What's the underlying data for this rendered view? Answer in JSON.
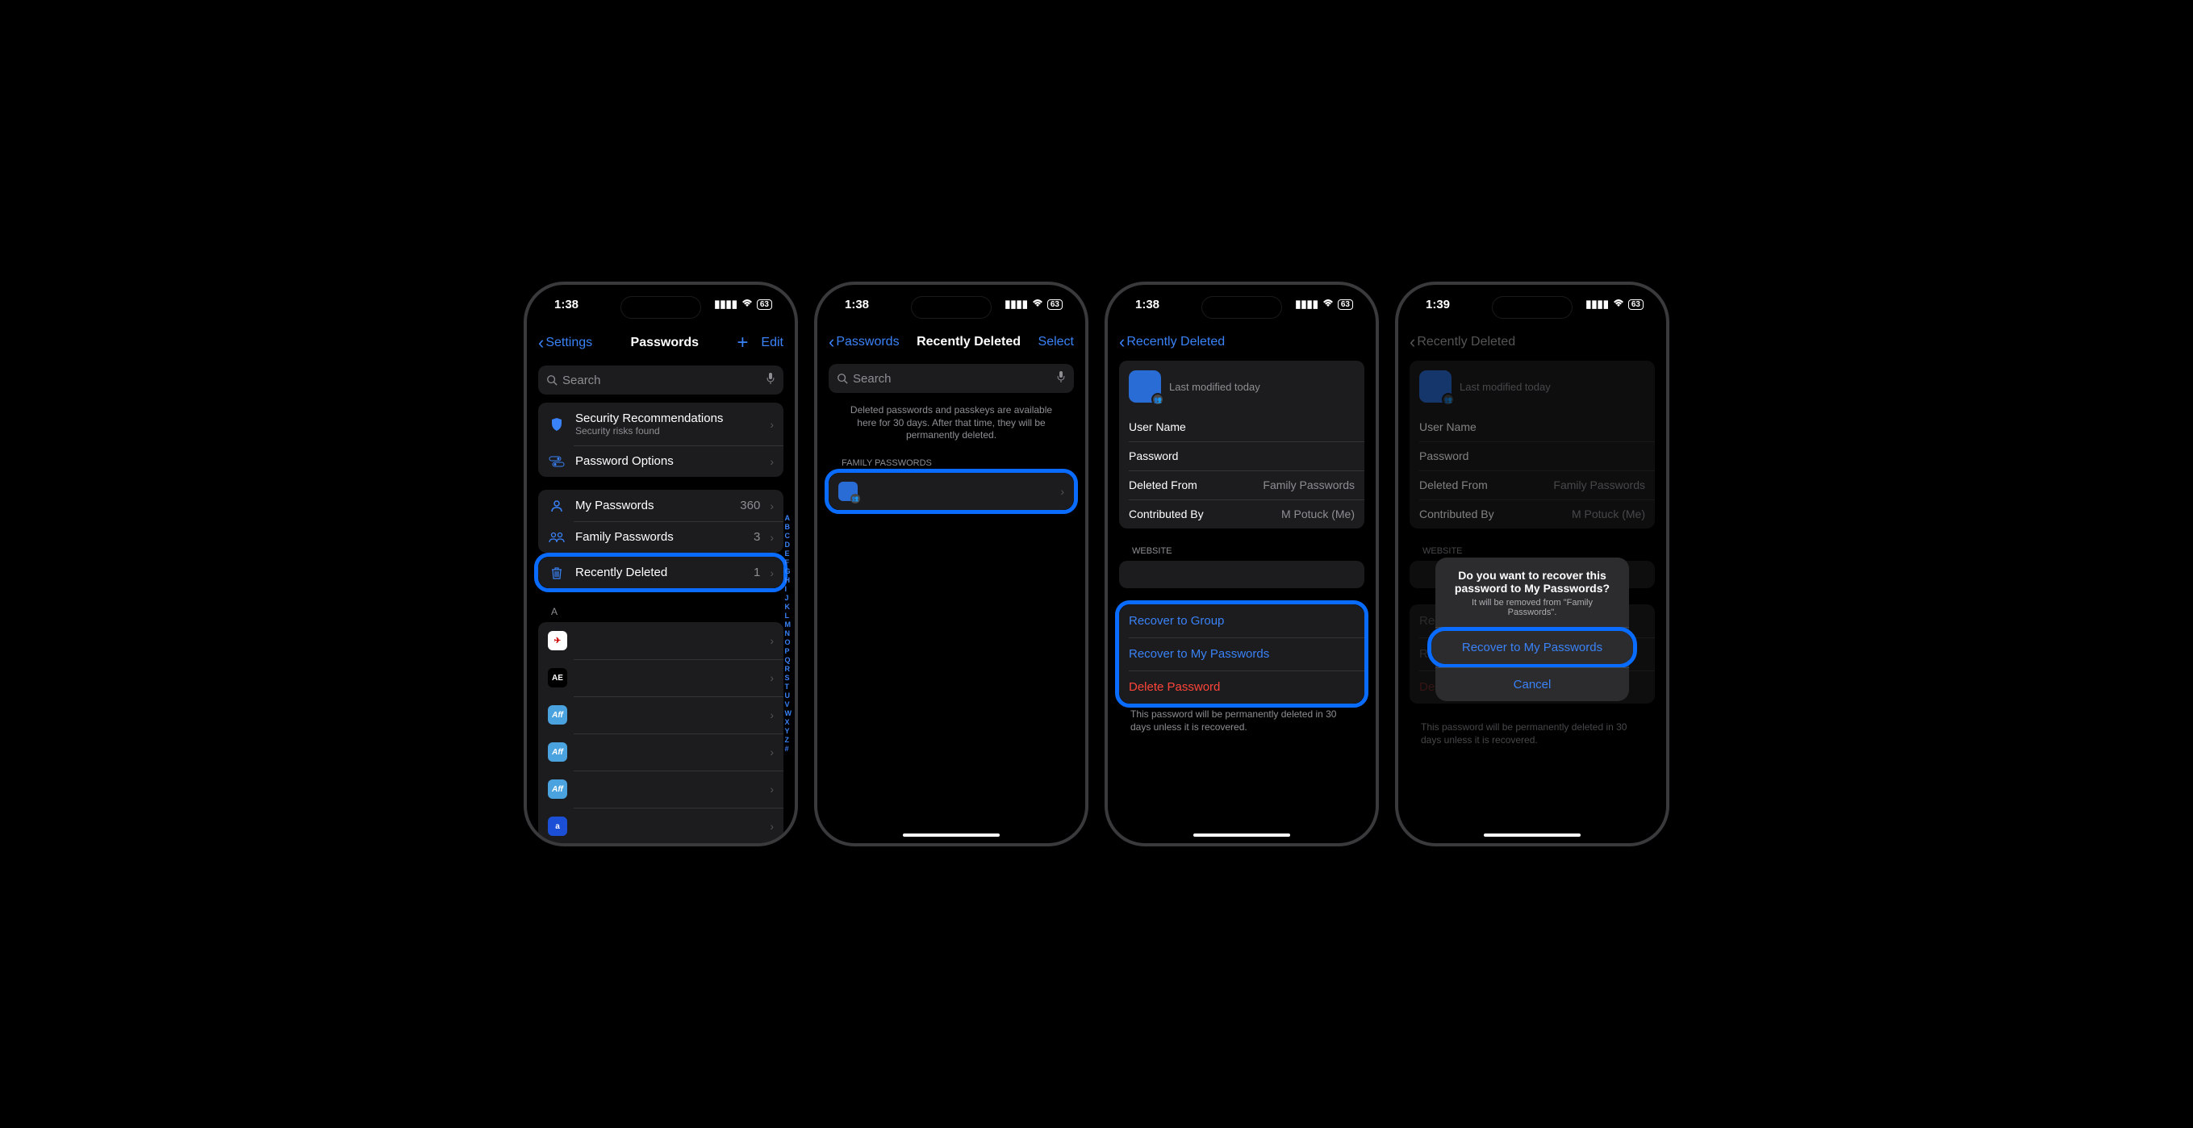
{
  "status": {
    "time1": "1:38",
    "time2": "1:39",
    "battery": "63"
  },
  "screen1": {
    "back": "Settings",
    "title": "Passwords",
    "edit": "Edit",
    "search_placeholder": "Search",
    "security_title": "Security Recommendations",
    "security_sub": "Security risks found",
    "options": "Password Options",
    "my_passwords": "My Passwords",
    "my_count": "360",
    "family": "Family Passwords",
    "family_count": "3",
    "recent": "Recently Deleted",
    "recent_count": "1",
    "section_a": "A",
    "index": [
      "A",
      "B",
      "C",
      "D",
      "E",
      "F",
      "G",
      "H",
      "I",
      "J",
      "K",
      "L",
      "M",
      "N",
      "O",
      "P",
      "Q",
      "R",
      "S",
      "T",
      "U",
      "V",
      "W",
      "X",
      "Y",
      "Z",
      "#"
    ]
  },
  "screen2": {
    "back": "Passwords",
    "title": "Recently Deleted",
    "select": "Select",
    "search_placeholder": "Search",
    "info": "Deleted passwords and passkeys are available here for 30 days. After that time, they will be permanently deleted.",
    "group_header": "FAMILY PASSWORDS"
  },
  "screen3": {
    "back": "Recently Deleted",
    "modified": "Last modified today",
    "rows": {
      "username": "User Name",
      "password": "Password",
      "deleted_from": "Deleted From",
      "deleted_from_val": "Family Passwords",
      "contributed": "Contributed By",
      "contributed_val": "M Potuck (Me)"
    },
    "website": "WEBSITE",
    "recover_group": "Recover to Group",
    "recover_my": "Recover to My Passwords",
    "delete": "Delete Password",
    "footer": "This password will be permanently deleted in 30 days unless it is recovered."
  },
  "screen4": {
    "back": "Recently Deleted",
    "alert_title": "Do you want to recover this password to My Passwords?",
    "alert_msg": "It will be removed from \"Family Passwords\".",
    "alert_recover": "Recover to My Passwords",
    "alert_cancel": "Cancel"
  }
}
